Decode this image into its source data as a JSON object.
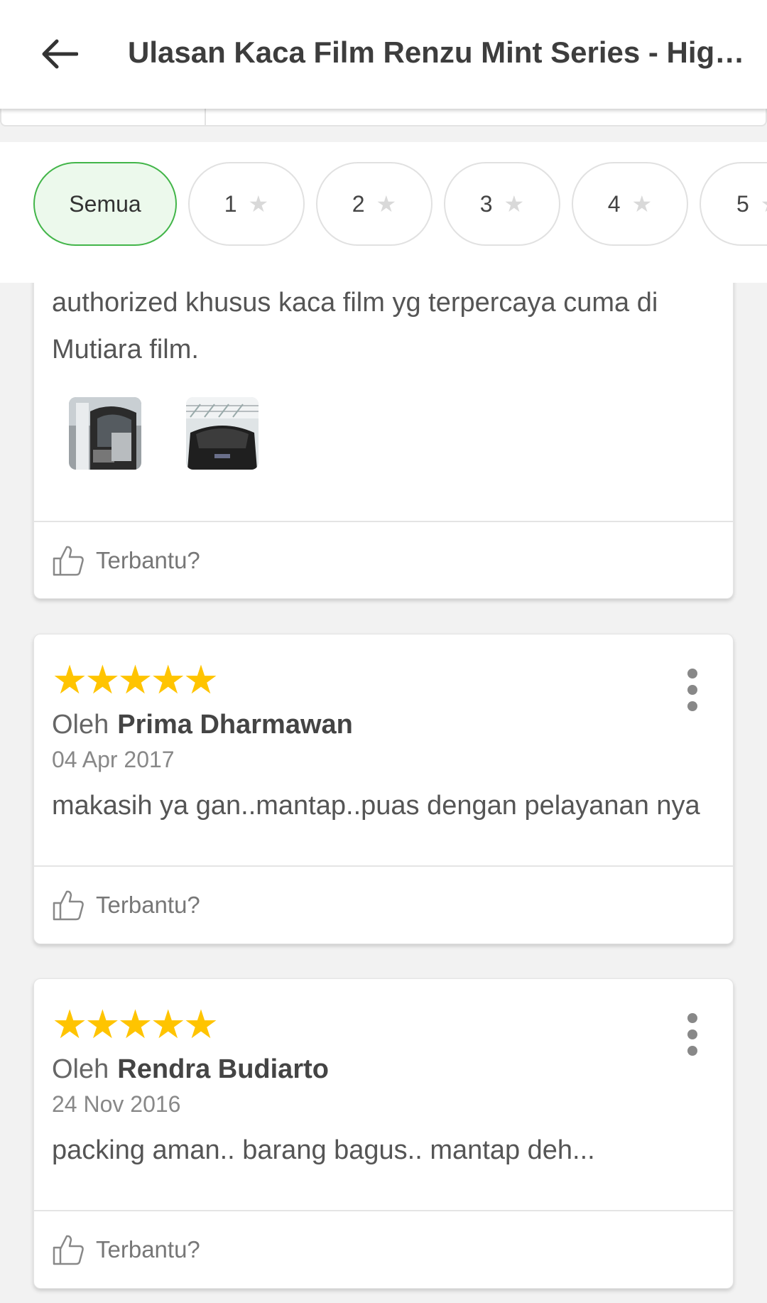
{
  "header": {
    "title": "Ulasan Kaca Film Renzu Mint Series - Higt P..."
  },
  "filters": [
    {
      "label": "Semua",
      "active": true
    },
    {
      "label": "1",
      "active": false
    },
    {
      "label": "2",
      "active": false
    },
    {
      "label": "3",
      "active": false
    },
    {
      "label": "4",
      "active": false
    },
    {
      "label": "5",
      "active": false
    }
  ],
  "reviews": [
    {
      "text_lines": [
        "authorized khusus kaca film yg terpercaya cuma di",
        "Mutiara film."
      ],
      "helpful_label": "Terbantu?"
    },
    {
      "rating": 5,
      "author_prefix": "Oleh",
      "author": "Prima Dharmawan",
      "date": "04 Apr 2017",
      "text": "makasih ya gan..mantap..puas dengan pelayanan nya",
      "helpful_label": "Terbantu?"
    },
    {
      "rating": 5,
      "author_prefix": "Oleh",
      "author": "Rendra Budiarto",
      "date": "24 Nov 2016",
      "text": "packing aman.. barang bagus.. mantap deh...",
      "helpful_label": "Terbantu?"
    }
  ],
  "colors": {
    "accent_green": "#42b549",
    "star_yellow": "#ffc400"
  }
}
